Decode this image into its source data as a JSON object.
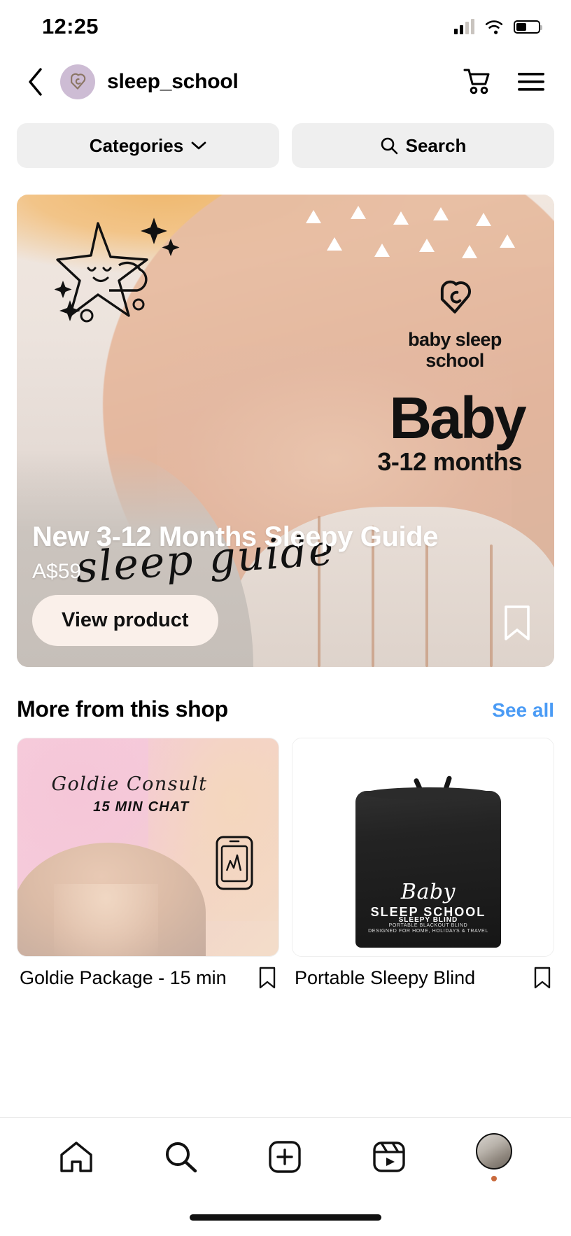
{
  "status_bar": {
    "time": "12:25",
    "signal_icon": "cellular-signal-icon",
    "wifi_icon": "wifi-icon",
    "battery_icon": "battery-icon"
  },
  "header": {
    "back_icon": "back-chevron-icon",
    "avatar_icon": "shop-avatar-icon",
    "shop_name": "sleep_school",
    "cart_icon": "shopping-cart-icon",
    "menu_icon": "hamburger-menu-icon"
  },
  "filters": {
    "categories_label": "Categories",
    "categories_chevron": "chevron-down-icon",
    "search_label": "Search",
    "search_icon": "search-icon"
  },
  "hero_product": {
    "title": "New 3-12 Months Sleepy Guide",
    "price": "A$59",
    "cta_label": "View product",
    "save_icon": "bookmark-icon",
    "image_text": {
      "brand_line1": "baby sleep",
      "brand_line2": "school",
      "headline": "Baby",
      "age_range": "3-12 months",
      "script": "sleep guide",
      "logo_icon": "heart-spiral-logo-icon",
      "star_doodle_icon": "star-cloud-doodle-icon"
    }
  },
  "more_section": {
    "title": "More from this shop",
    "see_all_label": "See all",
    "products": [
      {
        "label": "Goldie Package - 15 min",
        "save_icon": "bookmark-icon",
        "image_text": {
          "script": "Goldie Consult",
          "subtitle": "15 MIN CHAT",
          "phone_icon": "phone-doodle-icon"
        }
      },
      {
        "label": "Portable Sleepy Blind",
        "save_icon": "bookmark-icon",
        "image_text": {
          "brand_script": "Baby",
          "brand_caps": "SLEEP SCHOOL",
          "product_name": "SLEEPY BLIND",
          "tagline1": "PORTABLE BLACKOUT BLIND",
          "tagline2": "DESIGNED FOR HOME, HOLIDAYS & TRAVEL",
          "crown_icon": "crown-doodle-icon"
        }
      }
    ]
  },
  "bottom_nav": {
    "items": [
      {
        "icon": "home-icon",
        "name": "home"
      },
      {
        "icon": "search-icon",
        "name": "search"
      },
      {
        "icon": "create-plus-icon",
        "name": "create"
      },
      {
        "icon": "reels-icon",
        "name": "reels"
      },
      {
        "icon": "profile-avatar-icon",
        "name": "profile"
      }
    ]
  },
  "colors": {
    "link_blue": "#4a9bf5",
    "pill_grey": "#efefef",
    "cta_cream": "#faf0ea",
    "avatar_lavender": "#cdbcd4",
    "notification_dot": "#c96a3d"
  }
}
